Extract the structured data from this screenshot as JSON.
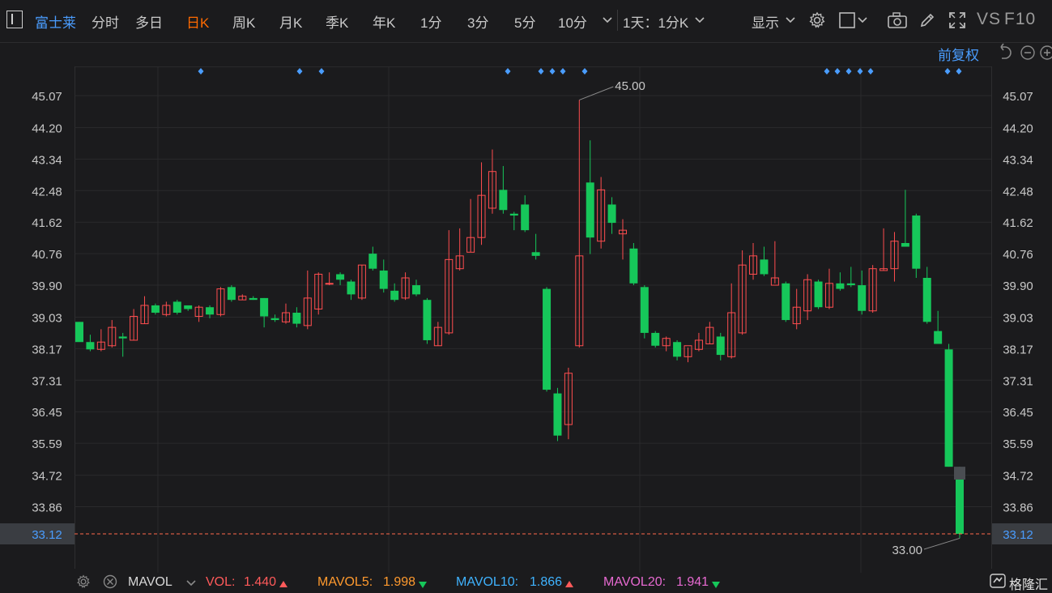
{
  "toolbar": {
    "title": "富士莱",
    "periods": [
      {
        "label": "分时",
        "active": false
      },
      {
        "label": "多日",
        "active": false
      },
      {
        "label": "日K",
        "active": true
      },
      {
        "label": "周K",
        "active": false
      },
      {
        "label": "月K",
        "active": false
      },
      {
        "label": "季K",
        "active": false
      },
      {
        "label": "年K",
        "active": false
      },
      {
        "label": "1分",
        "active": false
      },
      {
        "label": "3分",
        "active": false
      },
      {
        "label": "5分",
        "active": false
      },
      {
        "label": "10分",
        "active": false
      }
    ],
    "minute_select": "1天：1分K",
    "display_label": "显示",
    "vs_label": "VS",
    "f10_label": "F10",
    "adjust_label": "前复权"
  },
  "colors": {
    "background": "#1b1b1d",
    "up": "#ff4d4f",
    "down": "#16c75a",
    "accent": "#4a9dff",
    "active_tab": "#ff6a00",
    "current_price_line": "#ff6a4a"
  },
  "chart_data": {
    "type": "candlestick",
    "y_ticks": [
      "45.07",
      "44.20",
      "43.34",
      "42.48",
      "41.62",
      "40.76",
      "39.90",
      "39.03",
      "38.17",
      "37.31",
      "36.45",
      "35.59",
      "34.72",
      "33.86",
      "33.12"
    ],
    "ylim": [
      33.12,
      45.07
    ],
    "current_price": "33.12",
    "max_label": "45.00",
    "min_label": "33.00",
    "candles": [
      {
        "o": 38.9,
        "h": 38.9,
        "l": 38.4,
        "c": 38.35
      },
      {
        "o": 38.35,
        "h": 38.55,
        "l": 38.1,
        "c": 38.15
      },
      {
        "o": 38.15,
        "h": 38.7,
        "l": 38.1,
        "c": 38.35
      },
      {
        "o": 38.25,
        "h": 38.95,
        "l": 38.2,
        "c": 38.75
      },
      {
        "o": 38.5,
        "h": 38.6,
        "l": 37.95,
        "c": 38.45
      },
      {
        "o": 38.4,
        "h": 39.25,
        "l": 38.4,
        "c": 39.05
      },
      {
        "o": 38.85,
        "h": 39.6,
        "l": 38.85,
        "c": 39.35
      },
      {
        "o": 39.35,
        "h": 39.4,
        "l": 39.1,
        "c": 39.15
      },
      {
        "o": 39.1,
        "h": 39.45,
        "l": 39.05,
        "c": 39.35
      },
      {
        "o": 39.45,
        "h": 39.5,
        "l": 39.1,
        "c": 39.15
      },
      {
        "o": 39.35,
        "h": 39.35,
        "l": 39.2,
        "c": 39.25
      },
      {
        "o": 39.05,
        "h": 39.35,
        "l": 38.9,
        "c": 39.3
      },
      {
        "o": 39.3,
        "h": 39.35,
        "l": 39.0,
        "c": 39.1
      },
      {
        "o": 39.1,
        "h": 39.85,
        "l": 39.05,
        "c": 39.8
      },
      {
        "o": 39.85,
        "h": 39.9,
        "l": 39.45,
        "c": 39.5
      },
      {
        "o": 39.5,
        "h": 39.65,
        "l": 39.5,
        "c": 39.6
      },
      {
        "o": 39.55,
        "h": 39.6,
        "l": 39.5,
        "c": 39.5
      },
      {
        "o": 39.55,
        "h": 39.55,
        "l": 38.75,
        "c": 39.05
      },
      {
        "o": 39.0,
        "h": 39.1,
        "l": 38.9,
        "c": 38.95
      },
      {
        "o": 38.9,
        "h": 39.4,
        "l": 38.85,
        "c": 39.15
      },
      {
        "o": 39.15,
        "h": 39.3,
        "l": 38.75,
        "c": 38.85
      },
      {
        "o": 38.8,
        "h": 40.3,
        "l": 38.7,
        "c": 39.55
      },
      {
        "o": 39.25,
        "h": 40.25,
        "l": 39.1,
        "c": 40.2
      },
      {
        "o": 39.95,
        "h": 40.25,
        "l": 39.9,
        "c": 39.95
      },
      {
        "o": 40.2,
        "h": 40.25,
        "l": 39.9,
        "c": 40.05
      },
      {
        "o": 40.0,
        "h": 40.05,
        "l": 39.5,
        "c": 39.65
      },
      {
        "o": 39.55,
        "h": 40.45,
        "l": 39.5,
        "c": 40.45
      },
      {
        "o": 40.76,
        "h": 40.95,
        "l": 40.3,
        "c": 40.35
      },
      {
        "o": 40.3,
        "h": 40.6,
        "l": 39.7,
        "c": 39.8
      },
      {
        "o": 39.75,
        "h": 39.95,
        "l": 39.45,
        "c": 39.5
      },
      {
        "o": 39.55,
        "h": 40.25,
        "l": 39.5,
        "c": 40.1
      },
      {
        "o": 39.9,
        "h": 40.05,
        "l": 39.6,
        "c": 39.65
      },
      {
        "o": 39.5,
        "h": 39.55,
        "l": 38.3,
        "c": 38.4
      },
      {
        "o": 38.25,
        "h": 38.9,
        "l": 38.25,
        "c": 38.75
      },
      {
        "o": 38.6,
        "h": 41.4,
        "l": 38.55,
        "c": 40.6
      },
      {
        "o": 40.35,
        "h": 41.45,
        "l": 40.3,
        "c": 40.7
      },
      {
        "o": 40.8,
        "h": 42.25,
        "l": 40.8,
        "c": 41.2
      },
      {
        "o": 41.2,
        "h": 43.25,
        "l": 41.0,
        "c": 42.35
      },
      {
        "o": 42.0,
        "h": 43.6,
        "l": 41.85,
        "c": 43.0
      },
      {
        "o": 42.5,
        "h": 43.15,
        "l": 41.85,
        "c": 41.95
      },
      {
        "o": 41.85,
        "h": 41.9,
        "l": 41.4,
        "c": 41.8
      },
      {
        "o": 42.1,
        "h": 42.35,
        "l": 41.35,
        "c": 41.4
      },
      {
        "o": 40.8,
        "h": 41.3,
        "l": 40.6,
        "c": 40.7
      },
      {
        "o": 39.8,
        "h": 39.85,
        "l": 37.0,
        "c": 37.05
      },
      {
        "o": 36.95,
        "h": 37.1,
        "l": 35.65,
        "c": 35.8
      },
      {
        "o": 36.1,
        "h": 37.65,
        "l": 35.7,
        "c": 37.5
      },
      {
        "o": 38.25,
        "h": 44.95,
        "l": 38.2,
        "c": 40.7
      },
      {
        "o": 42.7,
        "h": 43.85,
        "l": 40.75,
        "c": 41.2
      },
      {
        "o": 41.1,
        "h": 42.85,
        "l": 40.9,
        "c": 42.5
      },
      {
        "o": 42.1,
        "h": 42.3,
        "l": 41.3,
        "c": 41.6
      },
      {
        "o": 41.3,
        "h": 41.7,
        "l": 40.6,
        "c": 41.4
      },
      {
        "o": 40.9,
        "h": 41.05,
        "l": 39.9,
        "c": 39.95
      },
      {
        "o": 39.85,
        "h": 39.9,
        "l": 38.45,
        "c": 38.6
      },
      {
        "o": 38.6,
        "h": 38.65,
        "l": 38.2,
        "c": 38.25
      },
      {
        "o": 38.25,
        "h": 38.5,
        "l": 38.1,
        "c": 38.45
      },
      {
        "o": 38.35,
        "h": 38.4,
        "l": 37.85,
        "c": 37.95
      },
      {
        "o": 37.95,
        "h": 38.2,
        "l": 37.8,
        "c": 38.25
      },
      {
        "o": 38.15,
        "h": 38.6,
        "l": 38.1,
        "c": 38.4
      },
      {
        "o": 38.3,
        "h": 38.9,
        "l": 38.3,
        "c": 38.75
      },
      {
        "o": 38.5,
        "h": 38.6,
        "l": 37.85,
        "c": 38.0
      },
      {
        "o": 37.95,
        "h": 39.95,
        "l": 37.9,
        "c": 39.15
      },
      {
        "o": 38.6,
        "h": 40.85,
        "l": 38.55,
        "c": 40.45
      },
      {
        "o": 40.2,
        "h": 41.05,
        "l": 40.05,
        "c": 40.7
      },
      {
        "o": 40.6,
        "h": 40.95,
        "l": 40.15,
        "c": 40.2
      },
      {
        "o": 39.9,
        "h": 41.1,
        "l": 39.95,
        "c": 40.1
      },
      {
        "o": 39.95,
        "h": 40.0,
        "l": 38.9,
        "c": 38.95
      },
      {
        "o": 38.85,
        "h": 39.8,
        "l": 38.7,
        "c": 39.3
      },
      {
        "o": 39.2,
        "h": 40.2,
        "l": 38.95,
        "c": 40.05
      },
      {
        "o": 40.0,
        "h": 40.05,
        "l": 39.25,
        "c": 39.3
      },
      {
        "o": 39.3,
        "h": 40.35,
        "l": 39.25,
        "c": 39.95
      },
      {
        "o": 39.95,
        "h": 40.25,
        "l": 39.75,
        "c": 39.8
      },
      {
        "o": 39.95,
        "h": 40.4,
        "l": 39.85,
        "c": 39.9
      },
      {
        "o": 39.9,
        "h": 40.3,
        "l": 39.1,
        "c": 39.2
      },
      {
        "o": 39.2,
        "h": 40.45,
        "l": 39.15,
        "c": 40.35
      },
      {
        "o": 40.3,
        "h": 41.45,
        "l": 40.3,
        "c": 40.35
      },
      {
        "o": 40.35,
        "h": 41.35,
        "l": 40.0,
        "c": 41.1
      },
      {
        "o": 41.05,
        "h": 42.5,
        "l": 40.95,
        "c": 40.95
      },
      {
        "o": 41.8,
        "h": 41.85,
        "l": 40.1,
        "c": 40.35
      },
      {
        "o": 40.1,
        "h": 40.4,
        "l": 38.85,
        "c": 38.9
      },
      {
        "o": 38.65,
        "h": 39.2,
        "l": 38.35,
        "c": 38.3
      },
      {
        "o": 38.15,
        "h": 38.3,
        "l": 34.95,
        "c": 34.95
      },
      {
        "o": 34.6,
        "h": 34.95,
        "l": 33.0,
        "c": 33.12
      }
    ]
  },
  "indicators": {
    "mavol_label": "MAVOL",
    "vol_label": "VOL:",
    "vol_value": "1.440",
    "mavol5_label": "MAVOL5:",
    "mavol5_value": "1.998",
    "mavol10_label": "MAVOL10:",
    "mavol10_value": "1.866",
    "mavol20_label": "MAVOL20:",
    "mavol20_value": "1.941"
  },
  "brand": "格隆汇"
}
